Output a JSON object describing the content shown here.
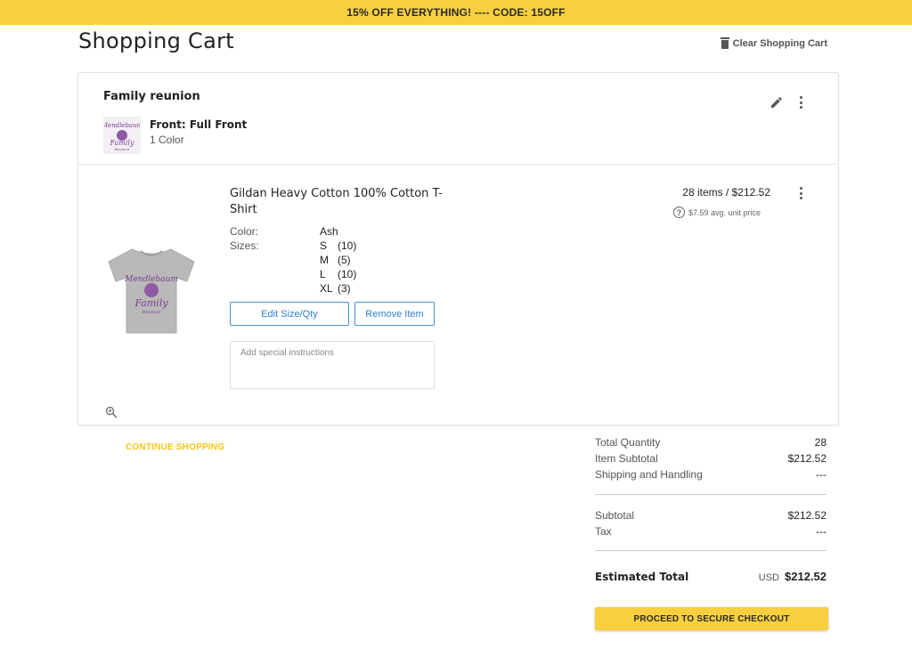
{
  "promo": {
    "text": "15% OFF EVERYTHING! ---- CODE: 15OFF"
  },
  "header": {
    "title": "Shopping Cart",
    "clear_label": "Clear Shopping Cart"
  },
  "design": {
    "name": "Family reunion",
    "front_label": "Front: Full Front",
    "color_count": "1 Color",
    "thumb_text_1": "Mendlebaum",
    "thumb_text_2": "Family",
    "thumb_text_3": "Reunion"
  },
  "product": {
    "name": "Gildan Heavy Cotton 100% Cotton T-Shirt",
    "color_label": "Color:",
    "color_value": "Ash",
    "sizes_label": "Sizes:",
    "sizes": [
      {
        "size": "S",
        "qty": "(10)"
      },
      {
        "size": "M",
        "qty": "(5)"
      },
      {
        "size": "L",
        "qty": "(10)"
      },
      {
        "size": "XL",
        "qty": "(3)"
      }
    ],
    "edit_label": "Edit Size/Qty",
    "remove_label": "Remove Item",
    "instructions_placeholder": "Add special instructions",
    "line_total": "28 items / $212.52",
    "avg_price": "$7.59 avg. unit price"
  },
  "continue_label": "CONTINUE SHOPPING",
  "summary": {
    "total_quantity_label": "Total Quantity",
    "total_quantity": "28",
    "item_subtotal_label": "Item Subtotal",
    "item_subtotal": "$212.52",
    "shipping_label": "Shipping and Handling",
    "shipping": "---",
    "subtotal_label": "Subtotal",
    "subtotal": "$212.52",
    "tax_label": "Tax",
    "tax": "---",
    "estimated_label": "Estimated Total",
    "currency": "USD",
    "estimated_total": "$212.52"
  },
  "checkout_label": "PROCEED TO SECURE CHECKOUT",
  "colors": {
    "accent_yellow": "#f8cf3f",
    "link_blue": "#2f7fcf",
    "shirt_ash": "#b9b9b9",
    "print_purple": "#7b3f8c"
  }
}
